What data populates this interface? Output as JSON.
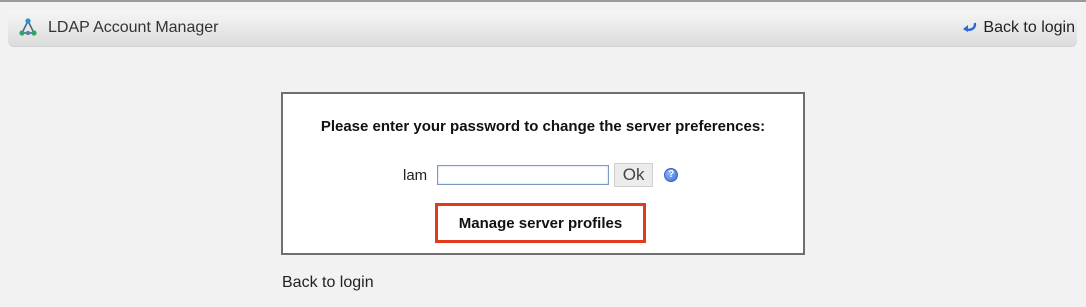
{
  "header": {
    "app_title": "LDAP Account Manager",
    "back_link": "Back to login",
    "logo_icon": "network-tree-icon",
    "back_icon": "return-arrow-icon"
  },
  "login_panel": {
    "prompt": "Please enter your password to change the server preferences:",
    "profile_label": "lam",
    "password_value": "",
    "ok_label": "Ok",
    "help_icon": "help-circle-icon",
    "manage_label": "Manage server profiles"
  },
  "footer": {
    "back_link": "Back to login"
  },
  "colors": {
    "highlight": "#e5391c",
    "help_icon": "#3f6fd6"
  }
}
